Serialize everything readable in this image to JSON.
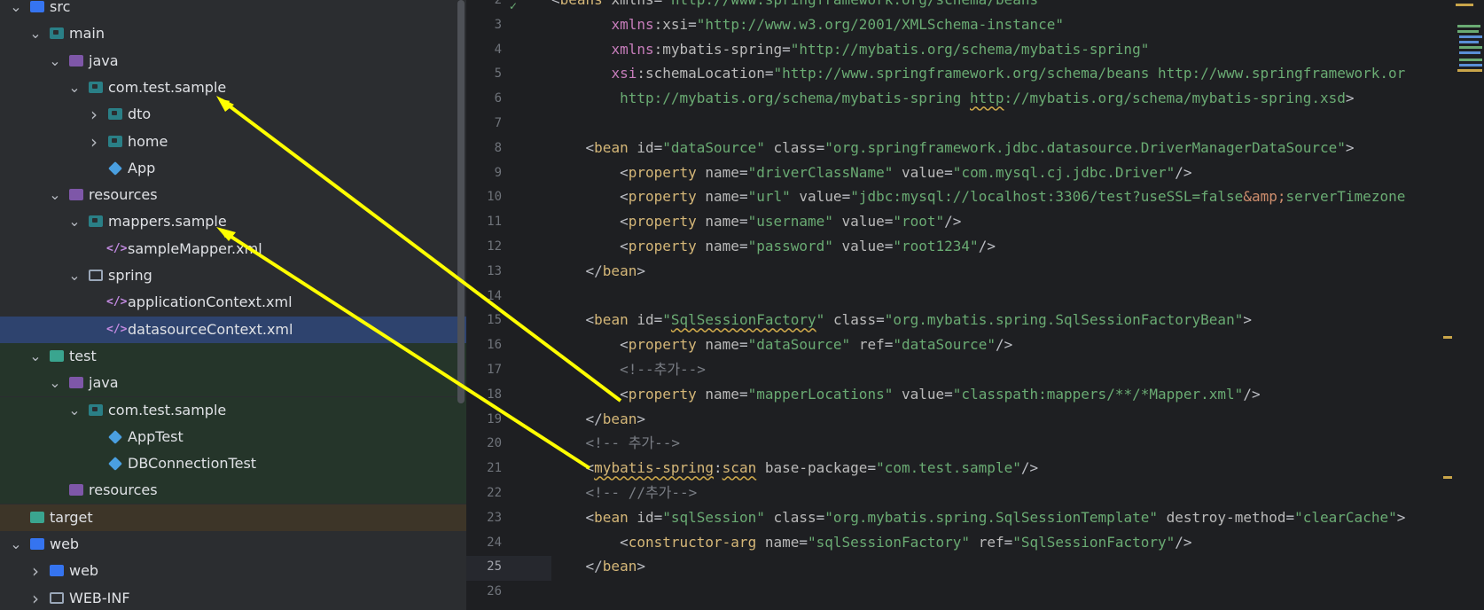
{
  "project_tree": {
    "items": [
      {
        "label": "src",
        "depth": 0,
        "icon": "source-root-folder-icon",
        "expanded": true
      },
      {
        "label": "main",
        "depth": 1,
        "icon": "module-folder-icon",
        "expanded": true
      },
      {
        "label": "java",
        "depth": 2,
        "icon": "source-folder-icon",
        "expanded": true
      },
      {
        "label": "com.test.sample",
        "depth": 3,
        "icon": "package-icon",
        "expanded": true
      },
      {
        "label": "dto",
        "depth": 4,
        "icon": "package-icon",
        "expanded": false
      },
      {
        "label": "home",
        "depth": 4,
        "icon": "package-icon",
        "expanded": false
      },
      {
        "label": "App",
        "depth": 4,
        "icon": "java-class-icon"
      },
      {
        "label": "resources",
        "depth": 2,
        "icon": "resources-folder-icon",
        "expanded": true
      },
      {
        "label": "mappers.sample",
        "depth": 3,
        "icon": "package-icon",
        "expanded": true
      },
      {
        "label": "sampleMapper.xml",
        "depth": 4,
        "icon": "xml-file-icon"
      },
      {
        "label": "spring",
        "depth": 3,
        "icon": "folder-icon",
        "expanded": true
      },
      {
        "label": "applicationContext.xml",
        "depth": 4,
        "icon": "xml-file-icon"
      },
      {
        "label": "datasourceContext.xml",
        "depth": 4,
        "icon": "xml-file-icon",
        "selected": true
      },
      {
        "label": "test",
        "depth": 1,
        "icon": "test-folder-icon",
        "expanded": true
      },
      {
        "label": "java",
        "depth": 2,
        "icon": "test-source-folder-icon",
        "expanded": true
      },
      {
        "label": "com.test.sample",
        "depth": 3,
        "icon": "package-icon",
        "expanded": true
      },
      {
        "label": "AppTest",
        "depth": 4,
        "icon": "java-class-icon"
      },
      {
        "label": "DBConnectionTest",
        "depth": 4,
        "icon": "java-class-icon"
      },
      {
        "label": "resources",
        "depth": 2,
        "icon": "test-resources-folder-icon"
      },
      {
        "label": "target",
        "depth": 0,
        "icon": "excluded-folder-icon"
      },
      {
        "label": "web",
        "depth": 0,
        "icon": "web-folder-icon",
        "expanded": true
      },
      {
        "label": "web",
        "depth": 1,
        "icon": "web-folder-icon",
        "expanded": false
      },
      {
        "label": "WEB-INF",
        "depth": 1,
        "icon": "folder-icon",
        "expanded": false
      }
    ]
  },
  "editor": {
    "current_line": "25",
    "line_numbers": [
      "2",
      "3",
      "4",
      "5",
      "6",
      "7",
      "8",
      "9",
      "10",
      "11",
      "12",
      "13",
      "14",
      "15",
      "16",
      "17",
      "18",
      "19",
      "20",
      "21",
      "22",
      "23",
      "24",
      "25",
      "26"
    ],
    "lines": [
      "<beans xmlns=\"http://www.springframework.org/schema/beans\"",
      "       xmlns:xsi=\"http://www.w3.org/2001/XMLSchema-instance\"",
      "       xmlns:mybatis-spring=\"http://mybatis.org/schema/mybatis-spring\"",
      "       xsi:schemaLocation=\"http://www.springframework.org/schema/beans http://www.springframework.or",
      "        http://mybatis.org/schema/mybatis-spring http://mybatis.org/schema/mybatis-spring.xsd\">",
      "",
      "    <bean id=\"dataSource\" class=\"org.springframework.jdbc.datasource.DriverManagerDataSource\">",
      "        <property name=\"driverClassName\" value=\"com.mysql.cj.jdbc.Driver\"/>",
      "        <property name=\"url\" value=\"jdbc:mysql://localhost:3306/test?useSSL=false&amp;serverTimezone",
      "        <property name=\"username\" value=\"root\"/>",
      "        <property name=\"password\" value=\"root1234\"/>",
      "    </bean>",
      "",
      "    <bean id=\"SqlSessionFactory\" class=\"org.mybatis.spring.SqlSessionFactoryBean\">",
      "        <property name=\"dataSource\" ref=\"dataSource\"/>",
      "        <!--추가-->",
      "        <property name=\"mapperLocations\" value=\"classpath:mappers/**/*Mapper.xml\"/>",
      "    </bean>",
      "    <!-- 추가-->",
      "    <mybatis-spring:scan base-package=\"com.test.sample\"/>",
      "    <!-- //추가-->",
      "    <bean id=\"sqlSession\" class=\"org.mybatis.spring.SqlSessionTemplate\" destroy-method=\"clearCache\">",
      "        <constructor-arg name=\"sqlSessionFactory\" ref=\"SqlSessionFactory\"/>",
      "    </bean>",
      ""
    ]
  },
  "colors": {
    "tree_bg": "#2b2d30",
    "editor_bg": "#1e1f22",
    "selection": "#2e436e",
    "annotation_arrow": "#ffff00"
  }
}
